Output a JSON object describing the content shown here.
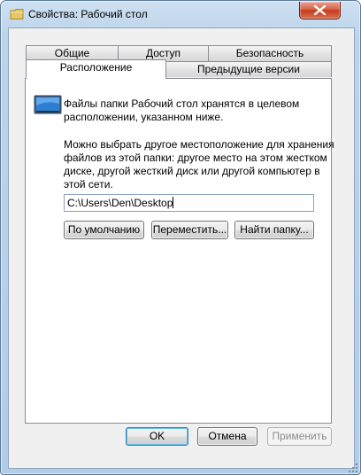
{
  "window": {
    "title": "Свойства: Рабочий стол"
  },
  "tabs": {
    "row1": [
      "Общие",
      "Доступ",
      "Безопасность"
    ],
    "row2": [
      "Расположение",
      "Предыдущие версии"
    ],
    "active": "Расположение"
  },
  "location": {
    "info_line1": "Файлы папки Рабочий стол хранятся в целевом",
    "info_line2": "расположении, указанном ниже.",
    "desc_line1": "Можно выбрать другое местоположение для хранения",
    "desc_line2": "файлов из этой папки: другое место на этом жестком",
    "desc_line3": "диске, другой жесткий диск или другой компьютер в",
    "desc_line4": "этой сети.",
    "path_value": "C:\\Users\\Den\\Desktop",
    "btn_default": "По умолчанию",
    "btn_move": "Переместить...",
    "btn_find": "Найти папку..."
  },
  "dialog_buttons": {
    "ok": "OK",
    "cancel": "Отмена",
    "apply": "Применить"
  },
  "icons": {
    "title": "folder-icon",
    "close": "close-icon",
    "location": "monitor-folder-icon"
  },
  "colors": {
    "frame": "#bcd3ea",
    "close_button": "#c7391c",
    "client_bg": "#f0f0f0",
    "focus_border": "#3c7fb1"
  }
}
